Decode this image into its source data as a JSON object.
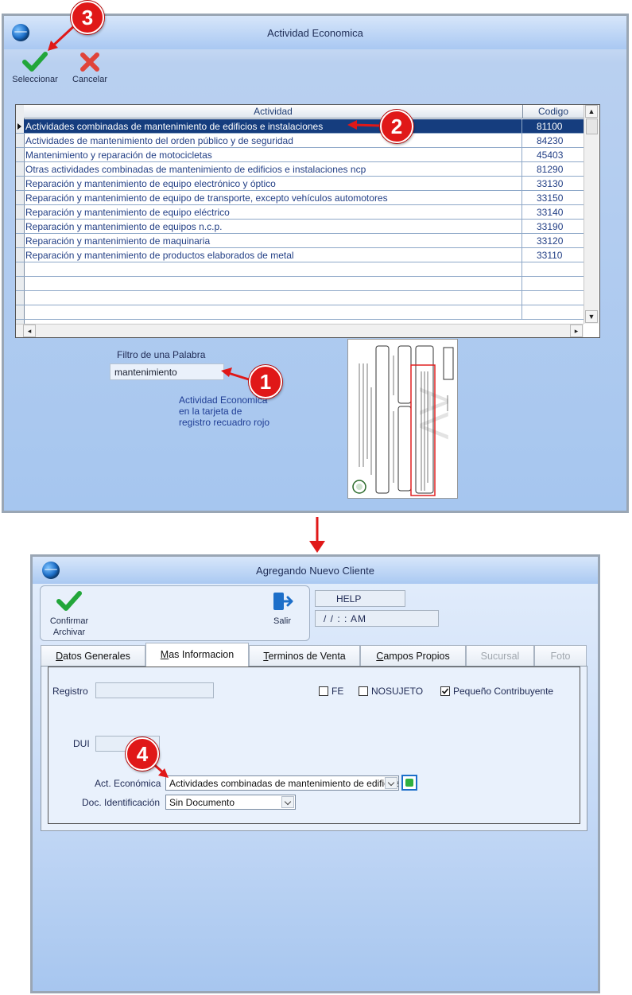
{
  "window1": {
    "title": "Actividad Economica",
    "toolbar": {
      "select_label": "Seleccionar",
      "cancel_label": "Cancelar"
    },
    "grid": {
      "columns": [
        "Actividad",
        "Codigo"
      ],
      "rows": [
        {
          "actividad": "Actividades combinadas de mantenimiento de edificios e instalaciones",
          "codigo": "81100"
        },
        {
          "actividad": "Actividades de mantenimiento del orden público y de seguridad",
          "codigo": "84230"
        },
        {
          "actividad": "Mantenimiento y reparación  de motocicletas",
          "codigo": "45403"
        },
        {
          "actividad": "Otras actividades combinadas de mantenimiento de edificios e instalaciones ncp",
          "codigo": "81290"
        },
        {
          "actividad": "Reparación y mantenimiento de equipo  electrónico y óptico",
          "codigo": "33130"
        },
        {
          "actividad": "Reparación y mantenimiento de equipo de transporte, excepto vehículos automotores",
          "codigo": "33150"
        },
        {
          "actividad": "Reparación y mantenimiento de equipo eléctrico",
          "codigo": "33140"
        },
        {
          "actividad": "Reparación y mantenimiento de equipos n.c.p.",
          "codigo": "33190"
        },
        {
          "actividad": "Reparación y mantenimiento de maquinaria",
          "codigo": "33120"
        },
        {
          "actividad": "Reparación y mantenimiento de productos elaborados de metal",
          "codigo": "33110"
        }
      ],
      "selected_index": 0
    },
    "filter": {
      "label": "Filtro de una Palabra",
      "value": "mantenimiento"
    },
    "note": "Actividad Economica en la tarjeta de registro recuadro rojo"
  },
  "badges": [
    "1",
    "2",
    "3",
    "4"
  ],
  "window2": {
    "title": "Agregando Nuevo Cliente",
    "toolbar": {
      "confirm_label_1": "Confirmar",
      "confirm_label_2": "Archivar",
      "exit_label": "Salir"
    },
    "help_field": "HELP",
    "time_field": "/ /      :  :  AM",
    "tabs": [
      {
        "label": "Datos Generales",
        "mnemonic": "D",
        "rest": "atos Generales"
      },
      {
        "label": "Mas Informacion",
        "mnemonic": "M",
        "rest": "as Informacion"
      },
      {
        "label": "Terminos de Venta",
        "mnemonic": "T",
        "rest": "erminos de Venta"
      },
      {
        "label": "Campos Propios",
        "mnemonic": "C",
        "rest": "ampos Propios"
      },
      {
        "label": "Sucursal"
      },
      {
        "label": "Foto"
      }
    ],
    "form": {
      "registro_label": "Registro",
      "registro_value": "",
      "dui_label": "DUI",
      "dui_value": "",
      "fe_label": "FE",
      "fe_checked": false,
      "nosujeto_label": "NOSUJETO",
      "nosujeto_checked": false,
      "pequeno_label": "Pequeño Contribuyente",
      "pequeno_checked": true,
      "act_label": "Act. Económica",
      "act_value": "Actividades combinadas de mantenimiento de edificios e instalaciones",
      "doc_label": "Doc. Identificación",
      "doc_value": "Sin Documento"
    }
  },
  "colors": {
    "selected_row": "#153d7e",
    "badge": "#e01818",
    "arrow": "#e01818",
    "check_green": "#22a63a",
    "cancel_red": "#e0443a"
  }
}
